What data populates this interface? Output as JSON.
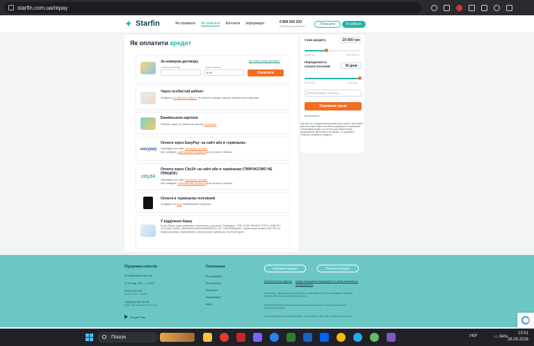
{
  "browser": {
    "url": "starfin.com.ua/repay"
  },
  "header": {
    "logo": "Starfin",
    "nav": [
      "Як отримати",
      "Як погасити",
      "Контакти",
      "Інформація"
    ],
    "phone": "0 800 202 233",
    "phone_note": "Потрібна допомога?",
    "pay_btn": "Погасити",
    "cabinet_btn": "В кабінет"
  },
  "main": {
    "title_pre": "Як оплатити",
    "title_accent": "кредит",
    "contract": {
      "title": "За номером договору",
      "help_link": "Де знайти номер договору?",
      "contract_label": "Номер договору",
      "contract_placeholder": "",
      "amount_label": "Сума платежу",
      "amount_value": "0.00",
      "pay_btn": "Сплатити"
    },
    "cabinet": {
      "title": "Через особистий кабінет",
      "text_pre": "Зайдіть в",
      "text_link": "особистий кабінет",
      "text_post": "та оплатіть кредит вашою банківською карткою"
    },
    "card": {
      "title": "Банківською карткою",
      "text_pre": "Оберіть суму та натисніть кнопку",
      "text_link": "Оплатити"
    },
    "easypay": {
      "logo": "easypay",
      "title": "Оплата через EasyPay: на сайті або в терміналах",
      "line1_pre": "Перейдіть на сайт",
      "line1_link": "Оплатити онлайн",
      "line2_pre": "або знайдіть",
      "line2_link": "найближчий термінал",
      "line2_post": "для оплати готівкою"
    },
    "city24": {
      "logo": "city24",
      "title": "Оплата через City24: на сайті або в терміналах (ТИМЧАСОВО НЕ ПРАЦЮЄ)",
      "line1_pre": "Перейдіть на сайт",
      "line1_link": "Оплатити онлайн",
      "line2_pre": "або знайдіть",
      "line2_link": "найближчий термінал",
      "line2_post": "для оплати готівкою"
    },
    "monobank": {
      "title": "Оплата в терміналах monobank",
      "text_pre": "Знайдіть на",
      "text_link": "мапі",
      "text_post": "найближчий термінал"
    },
    "bank": {
      "title": "У відділенні банку",
      "text": "В касі банку згідно реквізитів, зазначених у договорі. Отримувач: ТОВ «СТАР ФІНАНС ГРУП», ЄДРПОУ 43221638, IBAN: UA633395000000260050620010, АТ «ТАСКОМБАНК». Обов'язково вкажіть ПІБ, ІПН та номер договору. Зарахування платежу може тривати до 3 робочих днів."
    }
  },
  "calculator": {
    "sum_label": "Сума кредиту",
    "sum_value": "20 000 грн",
    "sum_min": "до 500 грн",
    "sum_max": "до 50 000 грн",
    "sum_fill": 0.4,
    "period_label": "Періодичність сплати платежів",
    "period_value": "30 днів",
    "period_min": "від 10 днів",
    "period_max": "до 30 днів",
    "period_fill": 1.0,
    "promo_placeholder": "Промокод/Введіть промокод",
    "get_btn": "Отримати гроші",
    "details": "Детальніше",
    "note": "Цей банк не є кредитним калькулятором оплати. Орієнтовна реальна річна ставка становить розрахунок за програмою «Терміновий кредит» до сплати для обраних умов кредитування. Детальніше про умови — в документі «Паспорт споживчого кредиту»."
  },
  "footer": {
    "support_heading": "Підтримка клієнтів",
    "email": "info@starfin.com.ua",
    "hours": "Пн-Нд: 9:00 — 21:00",
    "phone1": "0 800 202 233",
    "phone1_note": "Безкоштовно по Україні",
    "phone2": "+38(044) 220 20 33",
    "phone2_note": "Згідно тарифів вашого оператора",
    "google_play": "Google Play",
    "links_heading": "Посилання",
    "links": [
      "Як отримати",
      "Як погасити",
      "Контакти",
      "Інформація",
      "Акції"
    ],
    "btn_get": "Отримати кредит",
    "btn_pay": "Погасити кредит",
    "link_complaint": "Звернення на адресу",
    "link_info": "Щодо передання інформації та умов споживчого кредитування",
    "legal1": "Товариство з обмеженою відповідальністю «СТАР ФІНАНС ГРУП». Код ЄДРПОУ 43221638. Ліцензія НБУ на надання фінансових послуг.",
    "legal2": "Національний банк України здійснює державне регулювання та нагляд за діяльністю фінансових компаній.",
    "legal3": "Спосіб звернення до служби підтримки: • по телефону • через сайт • електронною поштою"
  },
  "taskbar": {
    "search": "Пошук",
    "lang": "УКР",
    "battery": "94%",
    "time": "13:51",
    "date": "28.09.2026"
  }
}
